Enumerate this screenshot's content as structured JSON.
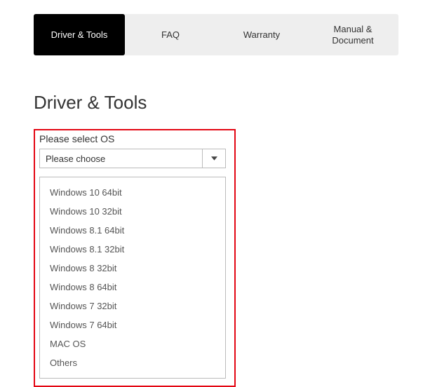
{
  "tabs": {
    "driver_tools": "Driver & Tools",
    "faq": "FAQ",
    "warranty": "Warranty",
    "manual_doc": "Manual & Document"
  },
  "heading": "Driver & Tools",
  "select": {
    "label": "Please select OS",
    "placeholder": "Please choose",
    "options": [
      "Windows 10 64bit",
      "Windows 10 32bit",
      "Windows 8.1 64bit",
      "Windows 8.1 32bit",
      "Windows 8 32bit",
      "Windows 8 64bit",
      "Windows 7 32bit",
      "Windows 7 64bit",
      "MAC OS",
      "Others"
    ]
  }
}
